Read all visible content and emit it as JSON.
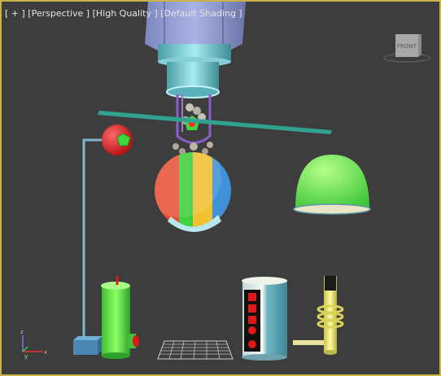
{
  "viewport": {
    "labels": {
      "plus": "[ + ]",
      "view": "[Perspective ]",
      "quality": "[High Quality ]",
      "shading": "[Default Shading ]"
    },
    "viewcube_face": "FRONT",
    "axes": {
      "x": "x",
      "y": "y",
      "z": "z"
    }
  },
  "colors": {
    "viewport_border": "#c9b34a",
    "viewport_bg": "#3d3d3d",
    "cyan": "#7fd1d8",
    "green": "#4fe35a",
    "red": "#e01818",
    "yellow": "#f5ef6a",
    "teal_bar": "#2fa390",
    "grid": "#cfcfcf"
  },
  "scene_objects": [
    "hex-nut",
    "pipe-cylinder",
    "marble-tube",
    "teal-bar",
    "red-sphere",
    "beach-ball",
    "green-dome",
    "rod-frame",
    "blue-box",
    "green-cylinder",
    "mesh-grid",
    "battery-cylinder",
    "coil-post"
  ]
}
